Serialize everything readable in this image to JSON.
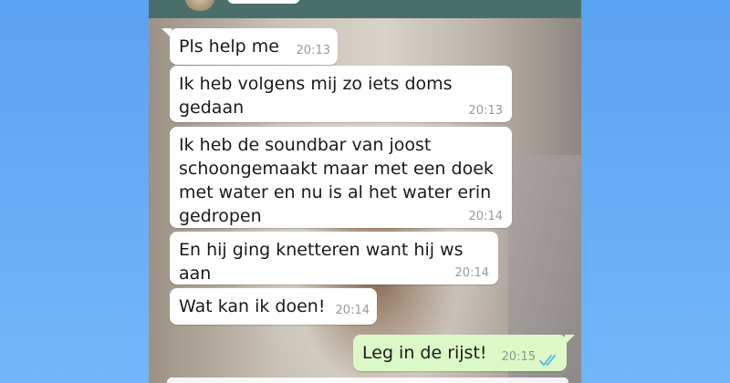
{
  "chat": {
    "messages": [
      {
        "direction": "incoming",
        "text": "Pls help me",
        "time": "20:13"
      },
      {
        "direction": "incoming",
        "text": "Ik heb volgens mij zo iets doms\ngedaan",
        "time": "20:13"
      },
      {
        "direction": "incoming",
        "text": "Ik heb de soundbar van joost\nschoongemaakt maar met een doek\nmet water en nu is al het water erin\ngedropen",
        "time": "20:14"
      },
      {
        "direction": "incoming",
        "text": "En hij ging knetteren want hij ws aan",
        "time": "20:14"
      },
      {
        "direction": "incoming",
        "text": "Wat kan ik doen!",
        "time": "20:14"
      },
      {
        "direction": "outgoing",
        "text": "Leg in de rijst!",
        "time": "20:15",
        "status": "read"
      }
    ]
  },
  "colors": {
    "background": "#5ea8f4",
    "header": "#4a6f6b",
    "incoming_bubble": "#ffffff",
    "outgoing_bubble": "#dcf8c6",
    "read_checks": "#4fb6ec"
  },
  "icons": {
    "read_status": "double-check-icon"
  }
}
